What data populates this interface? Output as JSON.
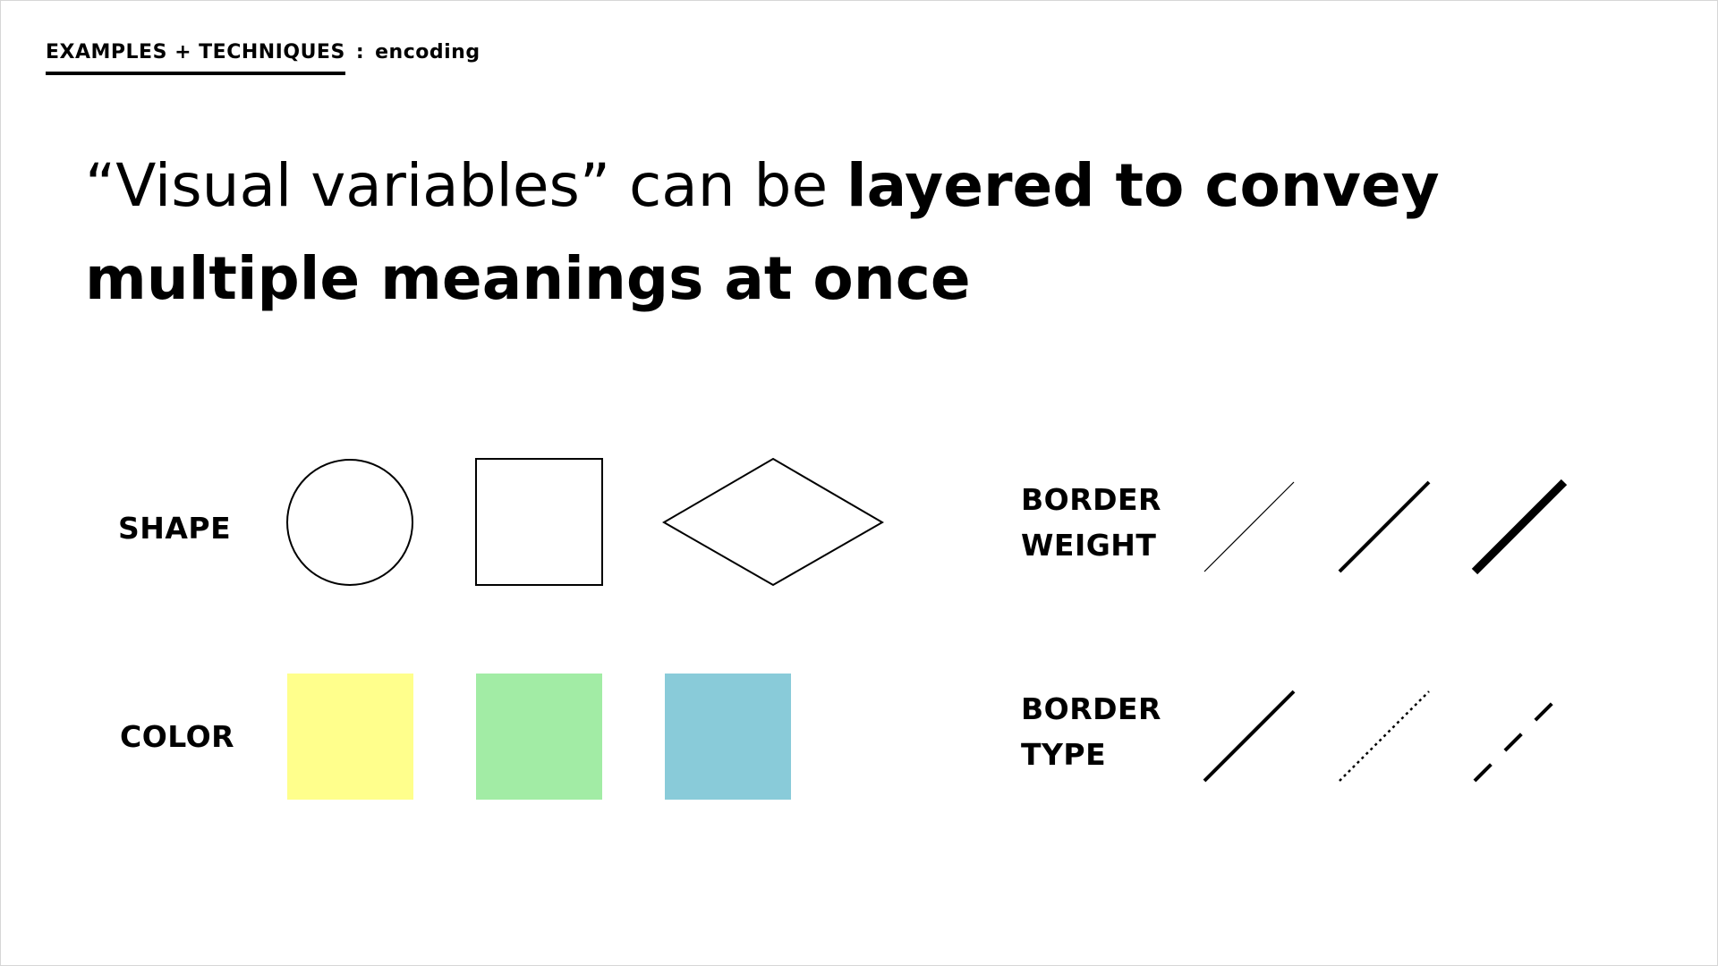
{
  "eyebrow": {
    "section": "EXAMPLES + TECHNIQUES",
    "separator": ":",
    "topic": "encoding"
  },
  "headline": {
    "plain": "“Visual variables” can be ",
    "emphasis": "layered to convey multiple meanings at once"
  },
  "rows": {
    "shape": {
      "label": "SHAPE",
      "items": [
        "circle-icon",
        "square-icon",
        "diamond-icon"
      ]
    },
    "color": {
      "label": "COLOR",
      "swatches": [
        "#ffff8c",
        "#a2eca5",
        "#89cbd9"
      ]
    },
    "border_weight": {
      "label_line1": "BORDER",
      "label_line2": "WEIGHT",
      "items": [
        "thin-line-icon",
        "medium-line-icon",
        "thick-line-icon"
      ]
    },
    "border_type": {
      "label_line1": "BORDER",
      "label_line2": "TYPE",
      "items": [
        "solid-line-icon",
        "dotted-line-icon",
        "dashed-line-icon"
      ]
    }
  }
}
